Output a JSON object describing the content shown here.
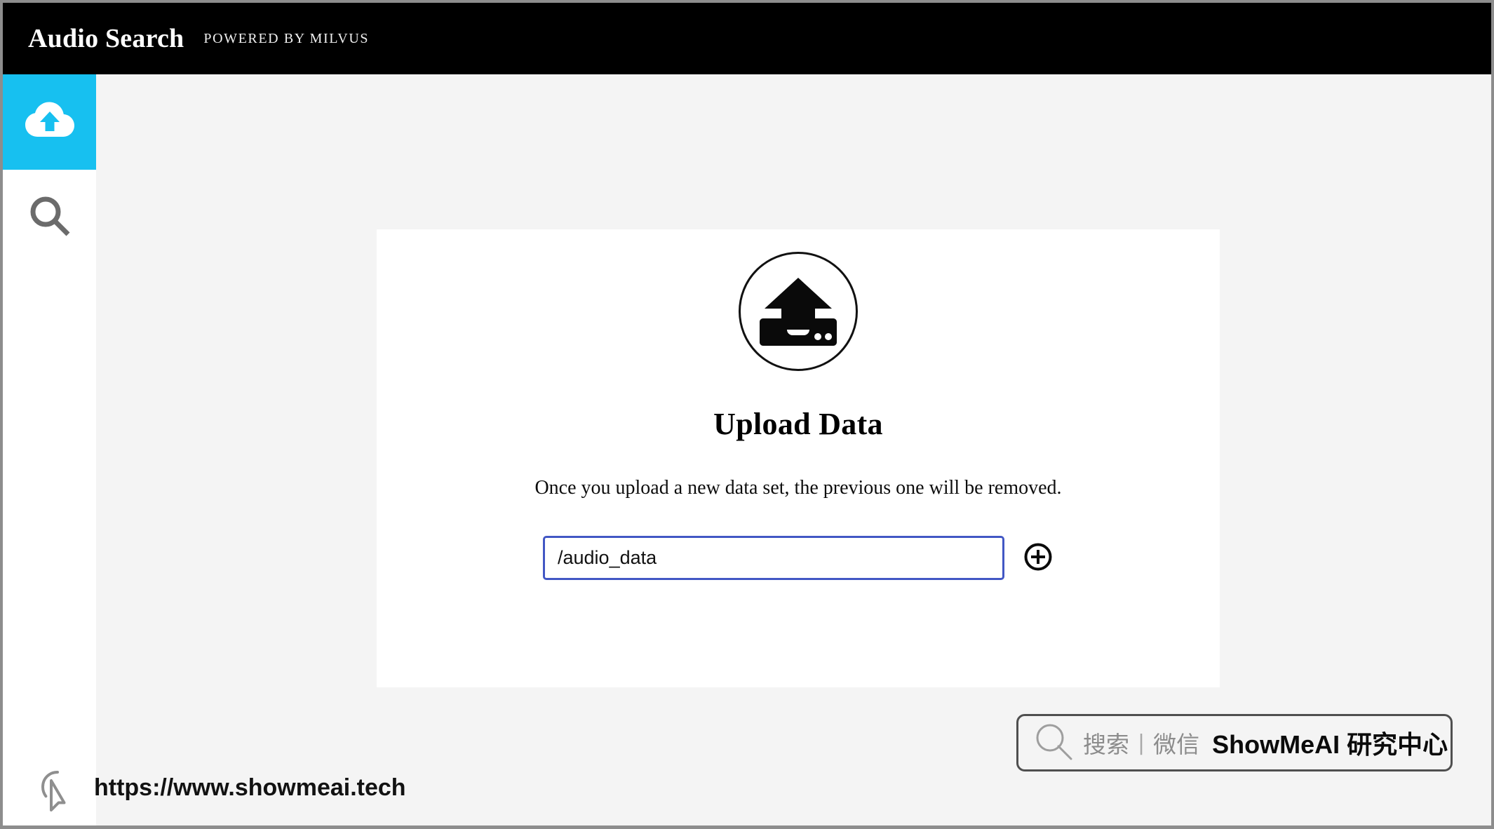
{
  "header": {
    "title": "Audio Search",
    "subtitle": "POWERED BY MILVUS",
    "background": "#000000"
  },
  "sidebar": {
    "active_index": 0,
    "accent_color": "#17c0f0",
    "items": [
      {
        "icon": "cloud-upload-icon",
        "label": "Upload",
        "active": true
      },
      {
        "icon": "search-icon",
        "label": "Search",
        "active": false
      }
    ]
  },
  "main": {
    "background": "#f4f4f4",
    "card": {
      "icon": "upload-tray-icon",
      "title": "Upload Data",
      "description": "Once you upload a new data set, the previous one will be removed.",
      "path_input": {
        "value": "/audio_data",
        "placeholder": "/audio_data",
        "border_color": "#4257c4"
      },
      "add_button": {
        "icon": "circle-plus-icon",
        "label": "Add"
      }
    }
  },
  "watermark": {
    "icon": "search-icon",
    "search_label": "搜索",
    "divider": "|",
    "channel_label": "微信",
    "brand": "ShowMeAI 研究中心"
  },
  "footer": {
    "cursor_icon": "pointer-cursor-icon",
    "url": "https://www.showmeai.tech"
  }
}
